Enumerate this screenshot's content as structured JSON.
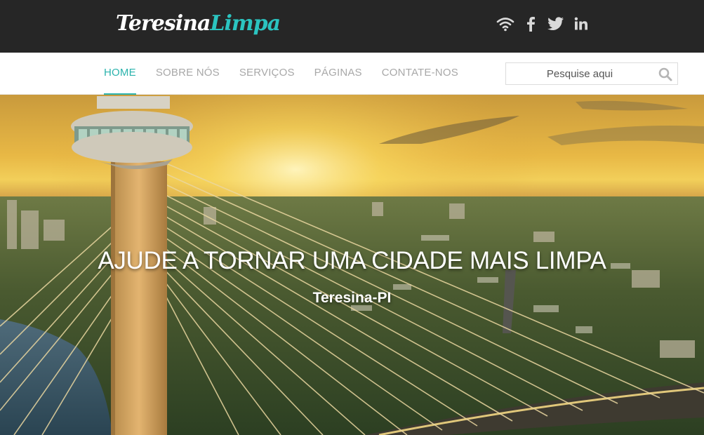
{
  "brand": {
    "logo_part1": "Teresina",
    "logo_part2": "Limpa",
    "accent_color": "#2bc4c0"
  },
  "social": [
    {
      "icon": "wifi-icon",
      "name": "rss"
    },
    {
      "icon": "facebook-icon",
      "name": "facebook"
    },
    {
      "icon": "twitter-icon",
      "name": "twitter"
    },
    {
      "icon": "linkedin-icon",
      "name": "linkedin"
    }
  ],
  "nav": {
    "items": [
      {
        "label": "HOME",
        "active": true
      },
      {
        "label": "SOBRE NÓS",
        "active": false
      },
      {
        "label": "SERVIÇOS",
        "active": false
      },
      {
        "label": "PÁGINAS",
        "active": false
      },
      {
        "label": "CONTATE-NOS",
        "active": false
      }
    ]
  },
  "search": {
    "placeholder": "Pesquise aqui",
    "value": "",
    "icon": "search-icon"
  },
  "hero": {
    "title": "AJUDE A TORNAR UMA CIDADE MAIS LIMPA",
    "subtitle": "Teresina-PI"
  }
}
